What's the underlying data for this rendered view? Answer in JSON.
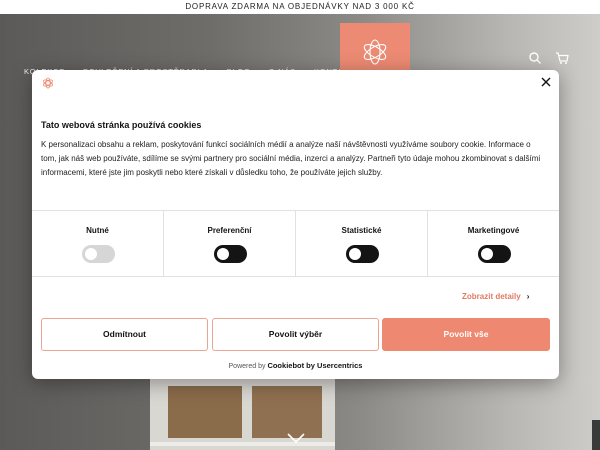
{
  "announcement": "DOPRAVA ZDARMA NA OBJEDNÁVKY NAD 3 000 KČ",
  "nav": {
    "links": [
      "KOLEKCE",
      "POVLEČENÍ A PROSTĚRADLA",
      "BLOG",
      "O NÁS",
      "KONTAKT"
    ],
    "search_icon": "search-icon",
    "cart_icon": "cart-icon"
  },
  "dialog": {
    "title": "Tato webová stránka používá cookies",
    "body": "K personalizaci obsahu a reklam, poskytování funkcí sociálních médií a analýze naší návštěvnosti využíváme soubory cookie. Informace o tom, jak náš web používáte, sdílíme se svými partnery pro sociální média, inzerci a analýzy. Partneři tyto údaje mohou zkombinovat s dalšími informacemi, které jste jim poskytli nebo které získali v důsledku toho, že používáte jejich služby.",
    "categories": [
      {
        "label": "Nutné",
        "enabled": true,
        "locked": true
      },
      {
        "label": "Preferenční",
        "enabled": false,
        "locked": false
      },
      {
        "label": "Statistické",
        "enabled": false,
        "locked": false
      },
      {
        "label": "Marketingové",
        "enabled": false,
        "locked": false
      }
    ],
    "details_label": "Zobrazit detaily",
    "buttons": {
      "deny": "Odmítnout",
      "allow_selection": "Povolit výběr",
      "allow_all": "Povolit vše"
    },
    "powered_prefix": "Powered by",
    "powered_brand": "Cookiebot by Usercentrics"
  },
  "colors": {
    "accent": "#ee8870",
    "toggle": "#141414"
  }
}
